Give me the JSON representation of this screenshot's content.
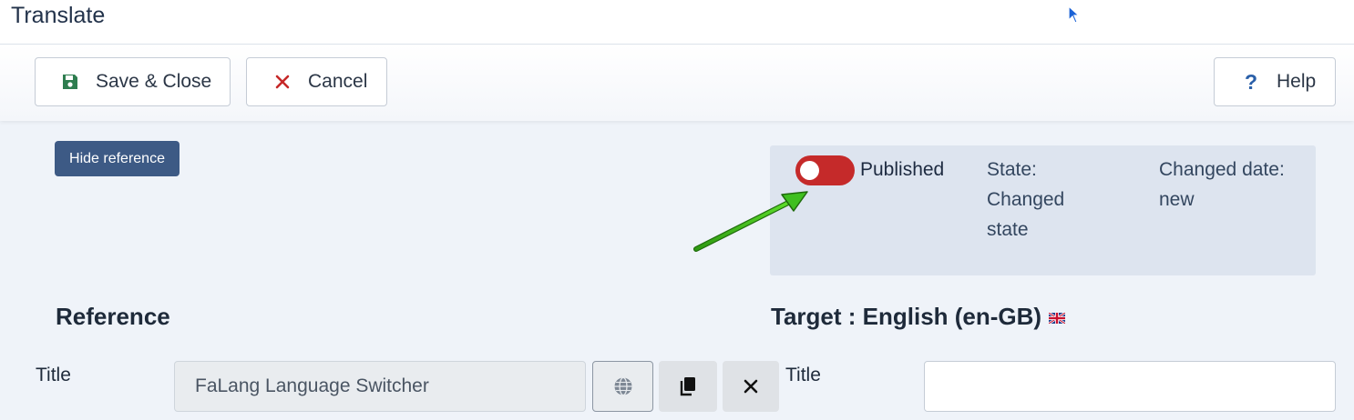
{
  "window": {
    "title": "Translate"
  },
  "toolbar": {
    "save_close_label": "Save & Close",
    "cancel_label": "Cancel",
    "help_label": "Help",
    "help_glyph": "?"
  },
  "reference_panel": {
    "toggle_button_label": "Hide reference",
    "heading": "Reference",
    "title_label": "Title",
    "title_value": "FaLang Language Switcher"
  },
  "status": {
    "published_label": "Published",
    "published_on": false,
    "state_text": "State: Changed state",
    "changed_date_text": "Changed date: new"
  },
  "target_panel": {
    "heading": "Target : English (en-GB)",
    "flag_icon": "uk-flag-icon",
    "title_label": "Title",
    "title_value": ""
  },
  "icons": {
    "save": "floppy-disk-icon",
    "cancel": "close-icon",
    "help": "question-icon",
    "globe": "globe-icon",
    "copy": "copy-icon",
    "clear": "close-icon"
  },
  "colors": {
    "toggle_off": "#c52a2a",
    "hide_reference_bg": "#3d5a85",
    "save_icon": "#2e7d4f",
    "cancel_icon": "#c62828",
    "help_icon": "#2a5fa8",
    "annotation_arrow": "#3fbf1f"
  }
}
